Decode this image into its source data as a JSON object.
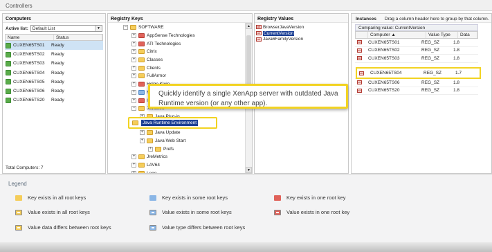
{
  "window_title": "Controllers",
  "computers": {
    "header": "Computers",
    "active_list_label": "Active list:",
    "active_list_value": "Default List",
    "col_name": "Name",
    "col_status": "Status",
    "rows": [
      {
        "name": "CUXEN65TS01",
        "status": "Ready"
      },
      {
        "name": "CUXEN65TS02",
        "status": "Ready"
      },
      {
        "name": "CUXEN65TS03",
        "status": "Ready"
      },
      {
        "name": "CUXEN65TS04",
        "status": "Ready"
      },
      {
        "name": "CUXEN65TS05",
        "status": "Ready"
      },
      {
        "name": "CUXEN65TS06",
        "status": "Ready"
      },
      {
        "name": "CUXEN65TS20",
        "status": "Ready"
      }
    ],
    "total": "Total Computers: 7"
  },
  "registry_keys": {
    "header": "Registry Keys",
    "items": [
      {
        "label": "SOFTWARE",
        "exp": "−",
        "color": "y"
      },
      {
        "label": "AppSense Technologies",
        "exp": "+",
        "color": "r"
      },
      {
        "label": "ATI Technologies",
        "exp": "+",
        "color": "r"
      },
      {
        "label": "Citrix",
        "exp": "+",
        "color": "y"
      },
      {
        "label": "Classes",
        "exp": "+",
        "color": "y"
      },
      {
        "label": "Clients",
        "exp": "+",
        "color": "y"
      },
      {
        "label": "FullArmor",
        "exp": "+",
        "color": "y"
      },
      {
        "label": "Helge Klein",
        "exp": "+",
        "color": "r"
      },
      {
        "label": "Hewlett-Packard",
        "exp": "+",
        "color": "b"
      },
      {
        "label": "Icarus",
        "exp": "+",
        "color": "r"
      },
      {
        "label": "JavaSoft",
        "exp": "−",
        "color": "y"
      },
      {
        "label": "Java Plug-in",
        "exp": "+",
        "color": "y"
      },
      {
        "label": "Java Runtime Environment",
        "exp": "+",
        "color": "y"
      },
      {
        "label": "Java Update",
        "exp": "+",
        "color": "y"
      },
      {
        "label": "Java Web Start",
        "exp": "+",
        "color": "y"
      },
      {
        "label": "Prefs",
        "exp": "+",
        "color": "y"
      },
      {
        "label": "JreMetrics",
        "exp": "+",
        "color": "y"
      },
      {
        "label": "LAV64",
        "exp": "+",
        "color": "y"
      },
      {
        "label": "Lego",
        "exp": "+",
        "color": "y"
      }
    ]
  },
  "registry_values": {
    "header": "Registry Values",
    "items": [
      "BrowserJavaVersion",
      "CurrentVersion",
      "Java6FamilyVersion"
    ],
    "selected": "CurrentVersion"
  },
  "instances": {
    "header": "Instances",
    "hint": "Drag a column header here to group by that column.",
    "comparing": "Comparing value: CurrentVersion",
    "col_computer": "Computer",
    "col_type": "Value Type",
    "col_data": "Data",
    "rows": [
      {
        "computer": "CUXEN65TS01",
        "type": "REG_SZ",
        "data": "1.8"
      },
      {
        "computer": "CUXEN65TS02",
        "type": "REG_SZ",
        "data": "1.8"
      },
      {
        "computer": "CUXEN65TS03",
        "type": "REG_SZ",
        "data": "1.8"
      },
      {
        "computer": "CUXEN65TS04",
        "type": "REG_SZ",
        "data": "1.7"
      },
      {
        "computer": "CUXEN65TS05",
        "type": "REG_SZ",
        "data": "1.8"
      },
      {
        "computer": "CUXEN65TS06",
        "type": "REG_SZ",
        "data": "1.8"
      },
      {
        "computer": "CUXEN65TS20",
        "type": "REG_SZ",
        "data": "1.8"
      }
    ]
  },
  "callout": "Quickly identify a single XenApp server with outdated Java Runtime version (or any other app).",
  "legend": {
    "title": "Legend",
    "items": [
      {
        "label": "Key exists in all root keys",
        "color": "#f5cd5a"
      },
      {
        "label": "Key exists in some root keys",
        "color": "#8ab6e6"
      },
      {
        "label": "Key exists in one root key",
        "color": "#e0625a"
      },
      {
        "label": "Value exists in all root keys",
        "color": "#f5cd5a"
      },
      {
        "label": "Value exists in some root keys",
        "color": "#8ab6e6"
      },
      {
        "label": "Value exists in one root key",
        "color": "#e0625a"
      },
      {
        "label": "Value data differs between root keys",
        "color": "#f5cd5a"
      },
      {
        "label": "Value type differs between root keys",
        "color": "#8ab6e6"
      }
    ]
  }
}
